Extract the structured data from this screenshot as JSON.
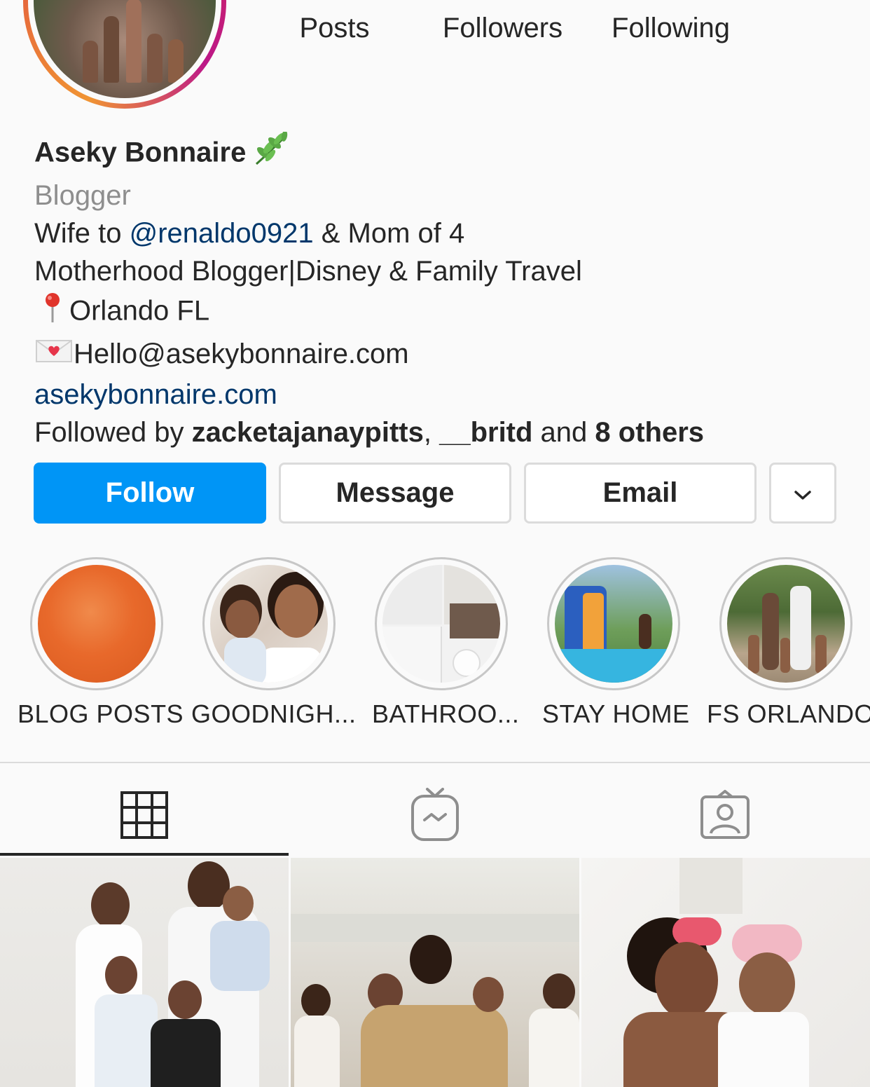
{
  "profile": {
    "name": "Aseky Bonnaire",
    "category": "Blogger",
    "bio_prefix": "Wife to ",
    "bio_mention": "@renaldo0921",
    "bio_suffix": " & Mom of 4",
    "bio_line2": "Motherhood Blogger|Disney & Family Travel",
    "location": "Orlando FL",
    "email": "Hello@asekybonnaire.com",
    "website": "asekybonnaire.com",
    "followed_by_prefix": "Followed by ",
    "followed_by_user1": "zacketajanaypitts",
    "followed_by_sep": ", ",
    "followed_by_user2": "__britd",
    "followed_by_and": " and ",
    "followed_by_others": "8 others",
    "name_emoji": "leaf-icon",
    "location_emoji": "pin-icon",
    "email_emoji": "love-letter-icon"
  },
  "stats": {
    "posts_label": "Posts",
    "followers_label": "Followers",
    "following_label": "Following"
  },
  "buttons": {
    "follow": "Follow",
    "message": "Message",
    "email": "Email",
    "more_icon": "chevron-down-icon"
  },
  "highlights": [
    {
      "label": "BLOG POSTS"
    },
    {
      "label": "GOODNIGH..."
    },
    {
      "label": "BATHROO..."
    },
    {
      "label": "STAY HOME"
    },
    {
      "label": "FS ORLANDO"
    }
  ],
  "tabs": {
    "active": "grid",
    "icons": [
      "grid-icon",
      "igtv-icon",
      "tagged-icon"
    ]
  },
  "colors": {
    "follow_button": "#0095f6",
    "link": "#00376b",
    "category": "#8e8e8e",
    "border": "#dbdbdb"
  }
}
